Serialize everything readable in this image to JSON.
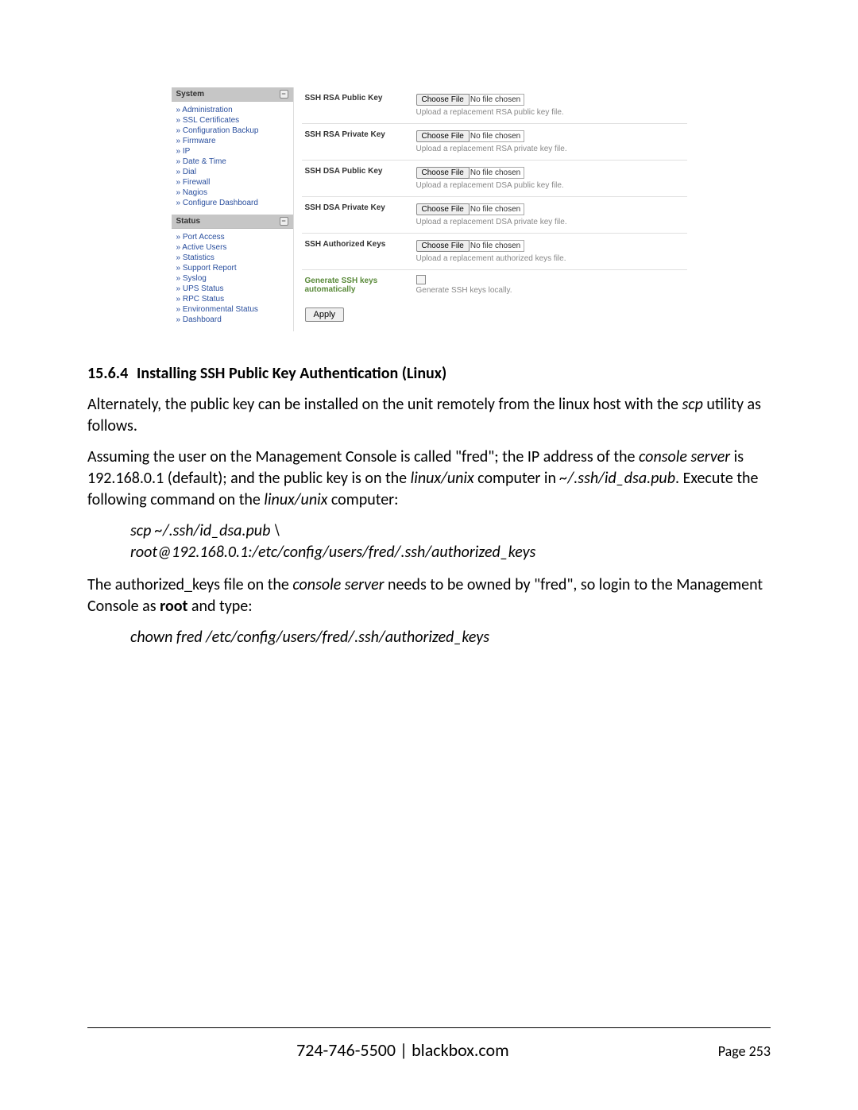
{
  "sidebar": {
    "system": {
      "title": "System",
      "items": [
        "Administration",
        "SSL Certificates",
        "Configuration Backup",
        "Firmware",
        "IP",
        "Date & Time",
        "Dial",
        "Firewall",
        "Nagios",
        "Configure Dashboard"
      ]
    },
    "status": {
      "title": "Status",
      "items": [
        "Port Access",
        "Active Users",
        "Statistics",
        "Support Report",
        "Syslog",
        "UPS Status",
        "RPC Status",
        "Environmental Status",
        "Dashboard"
      ]
    }
  },
  "form": {
    "rows": [
      {
        "label": "SSH RSA Public Key",
        "choose": "Choose File",
        "nofile": "No file chosen",
        "help": "Upload a replacement RSA public key file."
      },
      {
        "label": "SSH RSA Private Key",
        "choose": "Choose File",
        "nofile": "No file chosen",
        "help": "Upload a replacement RSA private key file."
      },
      {
        "label": "SSH DSA Public Key",
        "choose": "Choose File",
        "nofile": "No file chosen",
        "help": "Upload a replacement DSA public key file."
      },
      {
        "label": "SSH DSA Private Key",
        "choose": "Choose File",
        "nofile": "No file chosen",
        "help": "Upload a replacement DSA private key file."
      },
      {
        "label": "SSH Authorized Keys",
        "choose": "Choose File",
        "nofile": "No file chosen",
        "help": "Upload a replacement authorized keys file."
      }
    ],
    "gen_label_1": "Generate SSH keys",
    "gen_label_2": "automatically",
    "gen_help": "Generate SSH keys locally.",
    "apply": "Apply"
  },
  "doc": {
    "heading_num": "15.6.4",
    "heading_txt": "Installing SSH Public Key Authentication (Linux)",
    "p1a": "Alternately, the public key can be installed on the unit remotely from the linux host with the ",
    "p1b": "scp",
    "p1c": " utility as follows.",
    "p2a": "Assuming the user on the Management Console is called \"fred\"; the IP address of the ",
    "p2b": "console server",
    "p2c": " is 192.168.0.1 (default); and the public key is on the ",
    "p2d": "linux/unix",
    "p2e": " computer in ",
    "p2f": "~/.ssh/id_dsa.pub",
    "p2g": ". Execute the following command on the ",
    "p2h": "linux/unix",
    "p2i": " computer:",
    "cmd1a": "scp ~/.ssh/id_dsa.pub \\",
    "cmd1b": "root@192.168.0.1:/etc/config/users/fred/.ssh/authorized_keys",
    "p3a": "The authorized_keys file on the ",
    "p3b": "console server",
    "p3c": " needs to be owned by \"fred\", so login to the Management Console as ",
    "p3d": "root",
    "p3e": " and type:",
    "cmd2": "chown fred /etc/config/users/fred/.ssh/authorized_keys"
  },
  "footer": {
    "center": "724-746-5500 | blackbox.com",
    "right_label": "Page ",
    "right_num": "253"
  }
}
